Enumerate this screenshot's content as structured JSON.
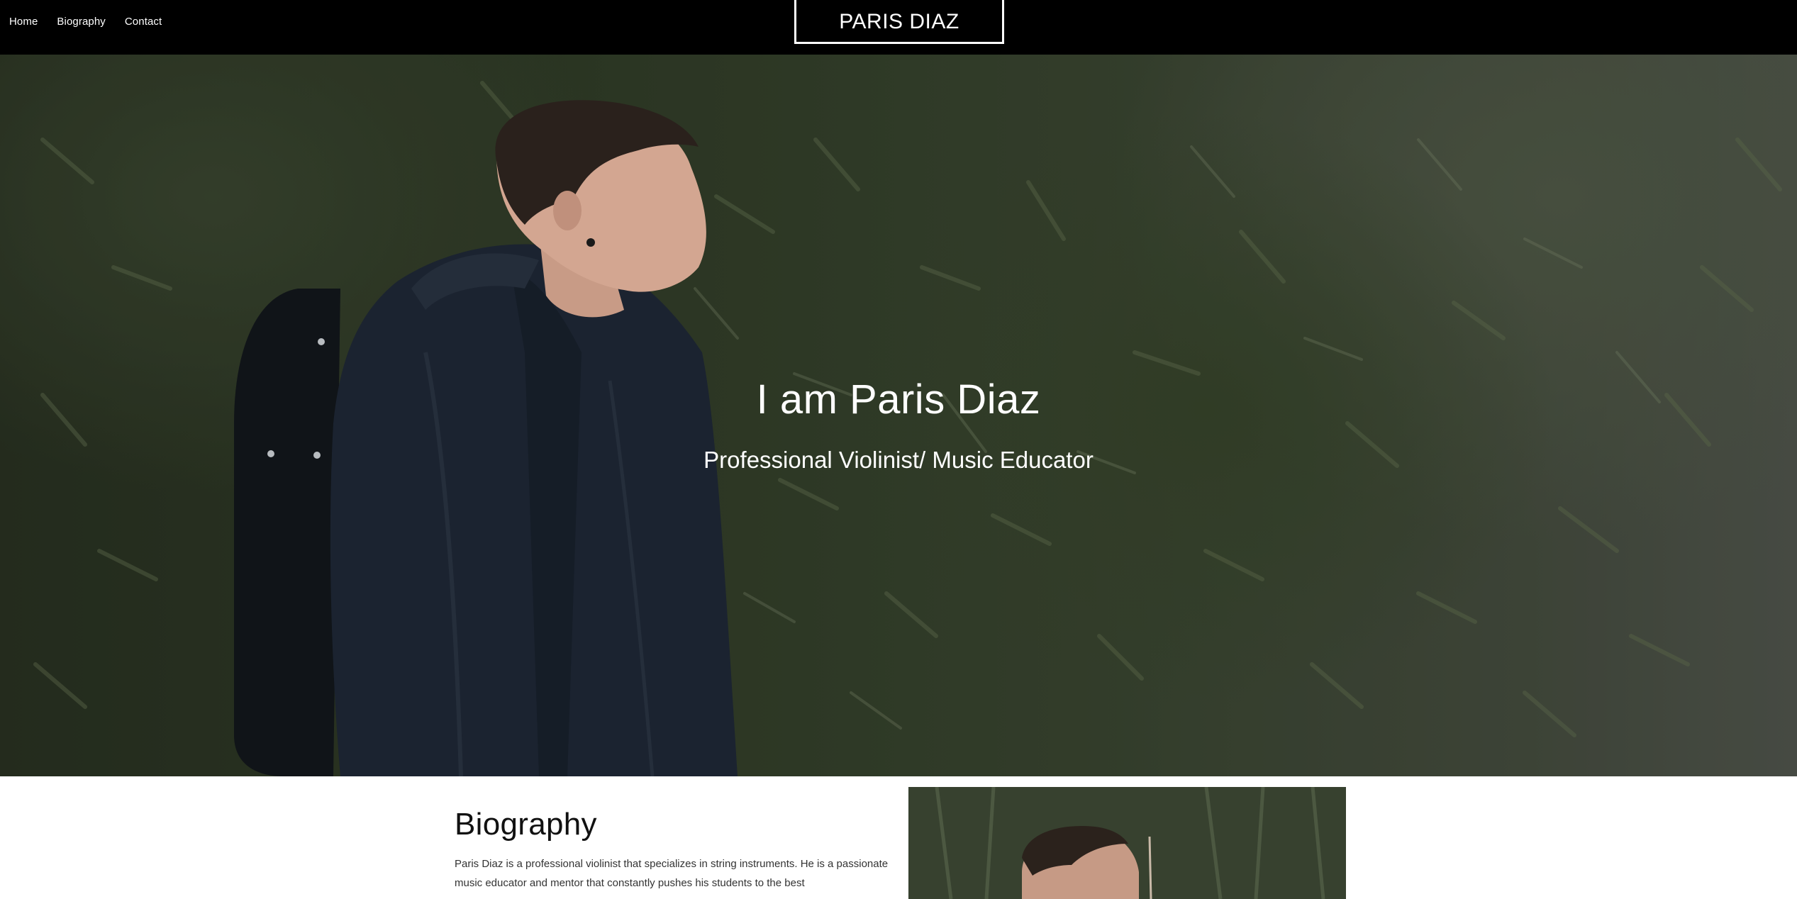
{
  "nav": {
    "items": [
      {
        "label": "Home"
      },
      {
        "label": "Biography"
      },
      {
        "label": "Contact"
      }
    ]
  },
  "brand": {
    "name": "PARIS DIAZ"
  },
  "hero": {
    "title": "I am Paris Diaz",
    "subtitle": "Professional Violinist/ Music Educator"
  },
  "biography": {
    "heading": "Biography",
    "text": "Paris Diaz is a professional violinist that specializes in string instruments. He is a passionate music educator and mentor that constantly pushes his students to the best"
  },
  "colors": {
    "topbar": "#000000",
    "hero_text": "#ffffff",
    "body_text": "#333333"
  }
}
